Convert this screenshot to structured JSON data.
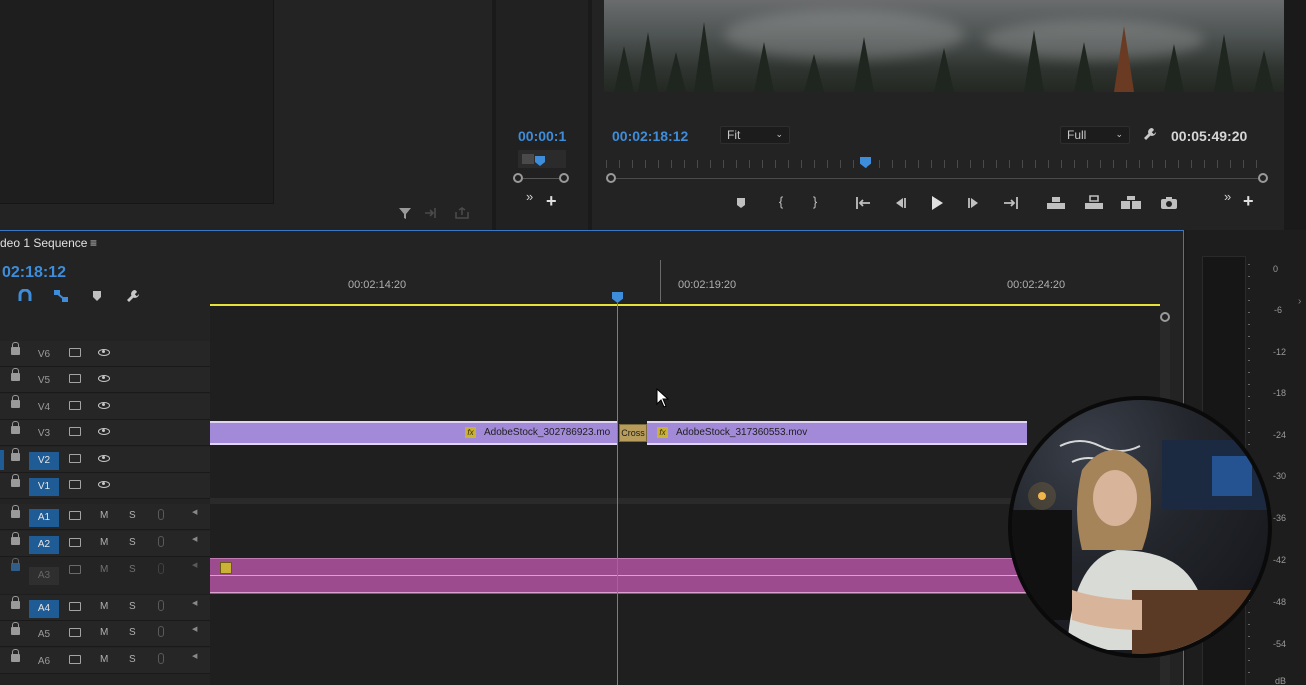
{
  "source_monitor": {
    "toolbar_icons": [
      "filter-icon",
      "insert-icon",
      "export-icon"
    ]
  },
  "mid_monitor": {
    "timecode": "00:00:1"
  },
  "program_monitor": {
    "timecode": "00:02:18:12",
    "fit_select": "Fit",
    "quality_select": "Full",
    "duration": "00:05:49:20",
    "controls": [
      "marker-icon",
      "mark-in-icon",
      "mark-out-icon",
      "go-to-in-icon",
      "step-back-icon",
      "play-icon",
      "step-forward-icon",
      "go-to-out-icon",
      "lift-icon",
      "extract-icon",
      "compare-icon",
      "camera-icon"
    ]
  },
  "timeline": {
    "title": "deo 1 Sequence",
    "timecode": "02:18:12",
    "ruler_labels": [
      "00:02:14:20",
      "00:02:19:20",
      "00:02:24:20"
    ],
    "video_tracks": [
      {
        "label": "V6",
        "active": false
      },
      {
        "label": "V5",
        "active": false
      },
      {
        "label": "V4",
        "active": false
      },
      {
        "label": "V3",
        "active": false
      },
      {
        "label": "V2",
        "active": true
      },
      {
        "label": "V1",
        "active": true
      }
    ],
    "audio_tracks": [
      {
        "label": "A1",
        "active": true,
        "m": "M",
        "s": "S"
      },
      {
        "label": "A2",
        "active": true,
        "m": "M",
        "s": "S"
      },
      {
        "label": "A3",
        "active": false,
        "m": "M",
        "s": "S"
      },
      {
        "label": "A4",
        "active": true,
        "m": "M",
        "s": "S"
      },
      {
        "label": "A5",
        "active": false,
        "m": "M",
        "s": "S"
      },
      {
        "label": "A6",
        "active": false,
        "m": "M",
        "s": "S"
      }
    ],
    "clips": {
      "clip1_name": "AdobeStock_302786923.mo",
      "transition_label": "Cross",
      "clip2_name": "AdobeStock_317360553.mov",
      "fx_label": "fx"
    }
  },
  "audio_meter": {
    "db_labels": [
      "0",
      "-6",
      "-12",
      "-18",
      "-24",
      "-30",
      "-36",
      "-42",
      "-48",
      "-54",
      "dB"
    ]
  },
  "colors": {
    "accent_blue": "#3e8ddb",
    "clip_violet": "#a28ad8",
    "audio_clip": "#9d4b8f",
    "work_area": "#e6e23a"
  }
}
